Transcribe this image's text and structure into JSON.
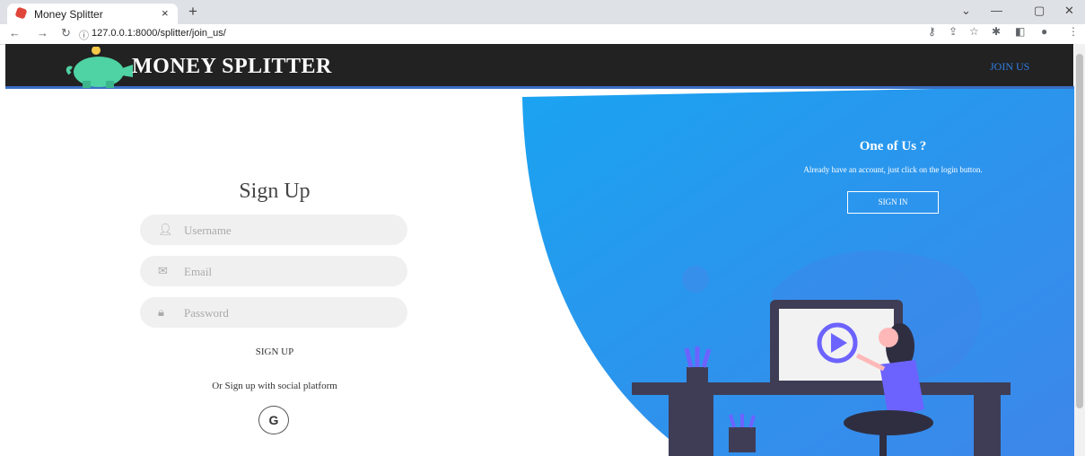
{
  "browser": {
    "tab_title": "Money Splitter",
    "tab_close": "×",
    "new_tab": "+",
    "url": "127.0.0.1:8000/splitter/join_us/",
    "window_controls": [
      "⌄",
      "—",
      "▢",
      "✕"
    ]
  },
  "header": {
    "brand": "MONEY SPLITTER",
    "nav_join": "JOIN US",
    "logo_icon": "piggy-bank-icon"
  },
  "form": {
    "title": "Sign Up",
    "username_placeholder": "Username",
    "email_placeholder": "Email",
    "password_placeholder": "Password",
    "submit_label": "SIGN UP",
    "social_text": "Or Sign up with social platform",
    "google_label": "G"
  },
  "panel": {
    "heading": "One of Us ?",
    "text": "Already have an account, just click on the login button.",
    "signin_label": "SIGN IN"
  },
  "colors": {
    "header_bg": "#222222",
    "accent": "#3b6fc4",
    "panel_blue": "#1aa3f0",
    "join_link": "#2f7fe6"
  }
}
